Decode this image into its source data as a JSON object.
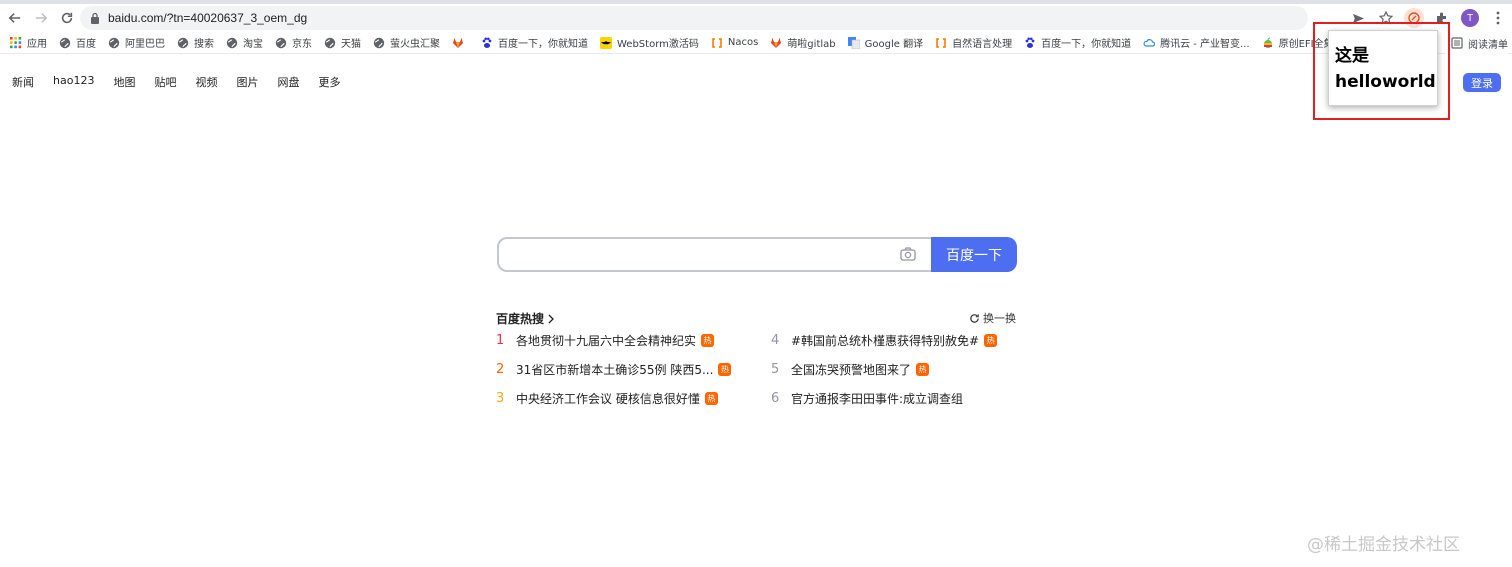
{
  "browser": {
    "url": "baidu.com/?tn=40020637_3_oem_dg",
    "avatar_letter": "T",
    "bookmarks": [
      {
        "label": "应用",
        "icon": "apps-grid-icon"
      },
      {
        "label": "百度",
        "icon": "globe-icon"
      },
      {
        "label": "阿里巴巴",
        "icon": "globe-icon"
      },
      {
        "label": "搜索",
        "icon": "globe-icon"
      },
      {
        "label": "淘宝",
        "icon": "globe-icon"
      },
      {
        "label": "京东",
        "icon": "globe-icon"
      },
      {
        "label": "天猫",
        "icon": "globe-icon"
      },
      {
        "label": "萤火虫汇聚",
        "icon": "globe-icon"
      },
      {
        "label": "",
        "icon": "gitlab-icon"
      },
      {
        "label": "百度一下，你就知道",
        "icon": "baidu-paw-icon"
      },
      {
        "label": "WebStorm激活码",
        "icon": "batman-icon"
      },
      {
        "label": "Nacos",
        "icon": "bracket-icon"
      },
      {
        "label": "萌啦gitlab",
        "icon": "gitlab-icon"
      },
      {
        "label": "Google 翻译",
        "icon": "translate-icon"
      },
      {
        "label": "自然语言处理",
        "icon": "bracket-icon"
      },
      {
        "label": "百度一下，你就知道",
        "icon": "baidu-paw-icon"
      },
      {
        "label": "腾讯云 - 产业智变...",
        "icon": "cloud-icon"
      },
      {
        "label": "原创EFI全集",
        "icon": "apple-icon"
      }
    ],
    "reading_list": "阅读清单"
  },
  "baidu": {
    "nav": [
      "新闻",
      "hao123",
      "地图",
      "贴吧",
      "视频",
      "图片",
      "网盘",
      "更多"
    ],
    "login": "登录",
    "search_button": "百度一下",
    "hot_title": "百度热搜",
    "refresh": "换一换",
    "hot_badge": "热",
    "hot_items": [
      {
        "rank": "1",
        "text": "各地贯彻十九届六中全会精神纪实",
        "hot": true,
        "color": "#fe2d46"
      },
      {
        "rank": "2",
        "text": "31省区市新增本土确诊55例 陕西5...",
        "hot": true,
        "color": "#f60"
      },
      {
        "rank": "3",
        "text": "中央经济工作会议 硬核信息很好懂",
        "hot": true,
        "color": "#faa90e"
      },
      {
        "rank": "4",
        "text": "#韩国前总统朴槿惠获得特别赦免#",
        "hot": true,
        "color": "#9195a3"
      },
      {
        "rank": "5",
        "text": "全国冻哭预警地图来了",
        "hot": true,
        "color": "#9195a3"
      },
      {
        "rank": "6",
        "text": "官方通报李田田事件:成立调查组",
        "hot": false,
        "color": "#9195a3"
      }
    ]
  },
  "popup": {
    "line1": "这是",
    "line2": "helloworld"
  },
  "watermark": "@稀土掘金技术社区"
}
